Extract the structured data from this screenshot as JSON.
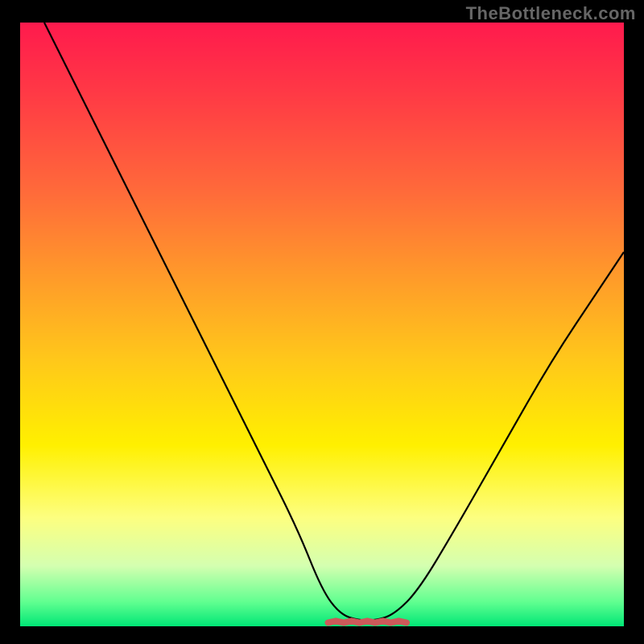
{
  "attribution": "TheBottleneck.com",
  "colors": {
    "background": "#000000",
    "gradient_top": "#ff1a4d",
    "gradient_mid": "#ffd400",
    "gradient_bottom": "#00e676",
    "curve": "#000000",
    "highlight": "#cc5a5a",
    "attribution_text": "#666666"
  },
  "chart_data": {
    "type": "line",
    "title": "",
    "xlabel": "",
    "ylabel": "",
    "xlim": [
      0,
      100
    ],
    "ylim": [
      0,
      100
    ],
    "grid": false,
    "legend": false,
    "series": [
      {
        "name": "bottleneck-curve",
        "x": [
          4,
          10,
          16,
          22,
          28,
          34,
          40,
          46,
          50,
          53,
          56,
          59,
          62,
          66,
          72,
          80,
          88,
          96,
          100
        ],
        "values": [
          100,
          88,
          76,
          64,
          52,
          40,
          28,
          16,
          6,
          2,
          1,
          1,
          2,
          6,
          16,
          30,
          44,
          56,
          62
        ]
      }
    ],
    "annotations": [
      {
        "name": "optimal-range-highlight",
        "type": "segment",
        "x_range": [
          51,
          64
        ],
        "y": 1,
        "color": "#cc5a5a"
      }
    ],
    "background_gradient": {
      "direction": "vertical",
      "stops": [
        {
          "pos": 0.0,
          "color": "#ff1a4d"
        },
        {
          "pos": 0.28,
          "color": "#ff6a3a"
        },
        {
          "pos": 0.56,
          "color": "#ffc81a"
        },
        {
          "pos": 0.82,
          "color": "#fdff80"
        },
        {
          "pos": 1.0,
          "color": "#00e676"
        }
      ]
    }
  }
}
